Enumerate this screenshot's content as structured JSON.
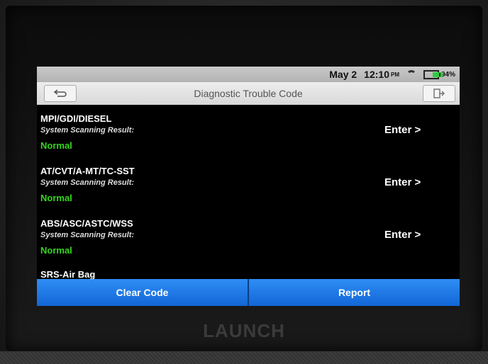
{
  "status_bar": {
    "date": "May 2",
    "time": "12:10",
    "ampm": "PM",
    "battery": "94%",
    "icons": [
      "wifi-icon",
      "battery-icon"
    ]
  },
  "title_bar": {
    "title": "Diagnostic Trouble Code",
    "back_icon": "back-arrow-icon",
    "exit_icon": "exit-icon"
  },
  "systems": [
    {
      "name": "MPI/GDI/DIESEL",
      "label": "System Scanning Result:",
      "status": "Normal",
      "action": "Enter >"
    },
    {
      "name": "AT/CVT/A-MT/TC-SST",
      "label": "System Scanning Result:",
      "status": "Normal",
      "action": "Enter >"
    },
    {
      "name": "ABS/ASC/ASTC/WSS",
      "label": "System Scanning Result:",
      "status": "Normal",
      "action": "Enter >"
    },
    {
      "name": "SRS-Air Bag"
    }
  ],
  "footer": {
    "clear_code": "Clear Code",
    "report": "Report"
  },
  "device": {
    "brand": "LAUNCH"
  },
  "colors": {
    "normal_status": "#35d61f",
    "footer_button": "#1f78e6"
  }
}
